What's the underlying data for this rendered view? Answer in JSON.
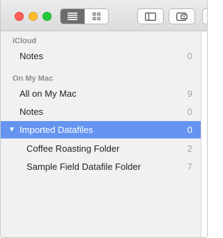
{
  "toolbar": {
    "view_modes": [
      {
        "name": "list",
        "icon": "list-icon",
        "active": true
      },
      {
        "name": "gallery",
        "icon": "grid-icon",
        "active": false
      }
    ],
    "buttons": [
      {
        "icon": "sidebar-toggle-icon"
      },
      {
        "icon": "attachment-browser-icon"
      }
    ]
  },
  "sidebar": {
    "sections": [
      {
        "title": "iCloud",
        "items": [
          {
            "label": "Notes",
            "count": "0"
          }
        ]
      },
      {
        "title": "On My Mac",
        "items": [
          {
            "label": "All on My Mac",
            "count": "9"
          },
          {
            "label": "Notes",
            "count": "0"
          },
          {
            "label": "Imported Datafiles",
            "count": "0",
            "expanded": true,
            "selected": true
          },
          {
            "label": "Coffee Roasting Folder",
            "count": "2"
          },
          {
            "label": "Sample Field Datafile Folder",
            "count": "7"
          }
        ]
      }
    ],
    "disclosure_glyph": "▼"
  },
  "colors": {
    "selection": "#6494f0",
    "close": "#fe5f57",
    "minimize": "#febc2e",
    "maximize": "#28c840"
  }
}
